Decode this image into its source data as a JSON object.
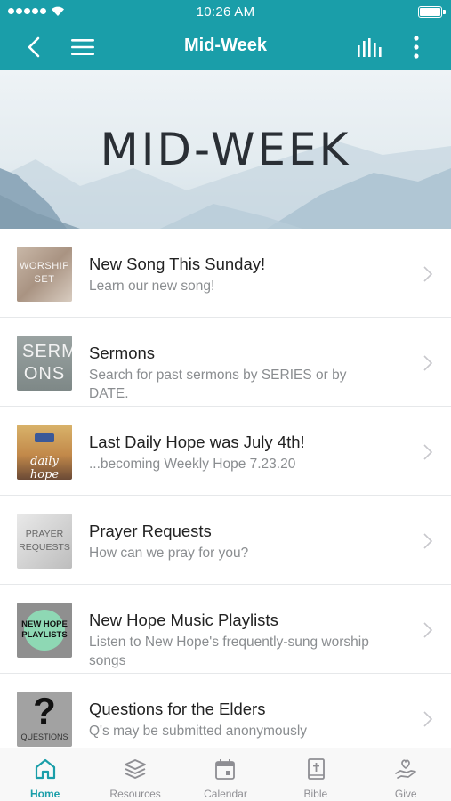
{
  "status_bar": {
    "time": "10:26 AM"
  },
  "nav": {
    "title": "Mid-Week"
  },
  "banner": {
    "title": "MID-WEEK"
  },
  "items": [
    {
      "title": "New Song This Sunday!",
      "subtitle": "Learn our new song!",
      "thumb_text": "WORSHIP SET"
    },
    {
      "title": "Sermons",
      "subtitle": "Search for past sermons by SERIES or by DATE.",
      "thumb_text": "SERM ONS"
    },
    {
      "title": "Last Daily Hope was July 4th!",
      "subtitle": "...becoming Weekly Hope 7.23.20",
      "thumb_text": "daily hope"
    },
    {
      "title": "Prayer Requests",
      "subtitle": "How can we pray for you?",
      "thumb_text": "PRAYER REQUESTS"
    },
    {
      "title": "New Hope Music Playlists",
      "subtitle": "Listen to New Hope's frequently-sung worship songs",
      "thumb_text": "NEW HOPE PLAYLISTS"
    },
    {
      "title": "Questions for the Elders",
      "subtitle": "Q's may be submitted anonymously",
      "thumb_text": "QUESTIONS"
    }
  ],
  "tabs": [
    {
      "label": "Home",
      "icon": "home-icon"
    },
    {
      "label": "Resources",
      "icon": "layers-icon"
    },
    {
      "label": "Calendar",
      "icon": "calendar-icon"
    },
    {
      "label": "Bible",
      "icon": "bible-icon"
    },
    {
      "label": "Give",
      "icon": "give-hand-icon"
    }
  ],
  "colors": {
    "accent": "#1a9ea9",
    "tab_inactive": "#8e8e93"
  }
}
